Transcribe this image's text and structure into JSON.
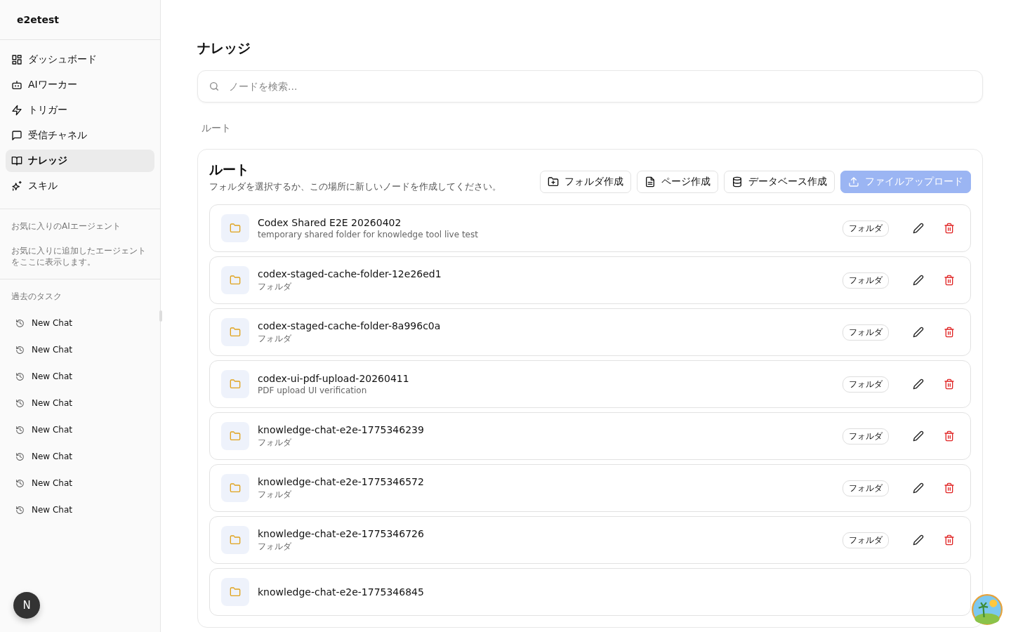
{
  "workspace": "e2etest",
  "nav": [
    {
      "label": "ダッシュボード",
      "selected": false
    },
    {
      "label": "AIワーカー",
      "selected": false
    },
    {
      "label": "トリガー",
      "selected": false
    },
    {
      "label": "受信チャネル",
      "selected": false
    },
    {
      "label": "ナレッジ",
      "selected": true
    },
    {
      "label": "スキル",
      "selected": false
    }
  ],
  "favorites": {
    "heading": "お気に入りのAIエージェント",
    "empty_text": "お気に入りに追加したエージェントをここに表示します。"
  },
  "tasks": {
    "heading": "過去のタスク",
    "items": [
      "New Chat",
      "New Chat",
      "New Chat",
      "New Chat",
      "New Chat",
      "New Chat",
      "New Chat",
      "New Chat"
    ]
  },
  "user_avatar": "N",
  "page_title": "ナレッジ",
  "search": {
    "placeholder": "ノードを検索..."
  },
  "breadcrumb": "ルート",
  "panel": {
    "title": "ルート",
    "description": "フォルダを選択するか、この場所に新しいノードを作成してください。",
    "actions": [
      {
        "label": "フォルダ作成",
        "primary": false,
        "disabled": false
      },
      {
        "label": "ページ作成",
        "primary": false,
        "disabled": false
      },
      {
        "label": "データベース作成",
        "primary": false,
        "disabled": false
      },
      {
        "label": "ファイルアップロード",
        "primary": true,
        "disabled": true
      }
    ],
    "nodes": [
      {
        "name": "Codex Shared E2E 20260402",
        "description": "temporary shared folder for knowledge tool live test",
        "type": "フォルダ"
      },
      {
        "name": "codex-staged-cache-folder-12e26ed1",
        "description": "フォルダ",
        "type": "フォルダ"
      },
      {
        "name": "codex-staged-cache-folder-8a996c0a",
        "description": "フォルダ",
        "type": "フォルダ"
      },
      {
        "name": "codex-ui-pdf-upload-20260411",
        "description": "PDF upload UI verification",
        "type": "フォルダ"
      },
      {
        "name": "knowledge-chat-e2e-1775346239",
        "description": "フォルダ",
        "type": "フォルダ"
      },
      {
        "name": "knowledge-chat-e2e-1775346572",
        "description": "フォルダ",
        "type": "フォルダ"
      },
      {
        "name": "knowledge-chat-e2e-1775346726",
        "description": "フォルダ",
        "type": "フォルダ"
      },
      {
        "name": "knowledge-chat-e2e-1775346845"
      }
    ]
  }
}
